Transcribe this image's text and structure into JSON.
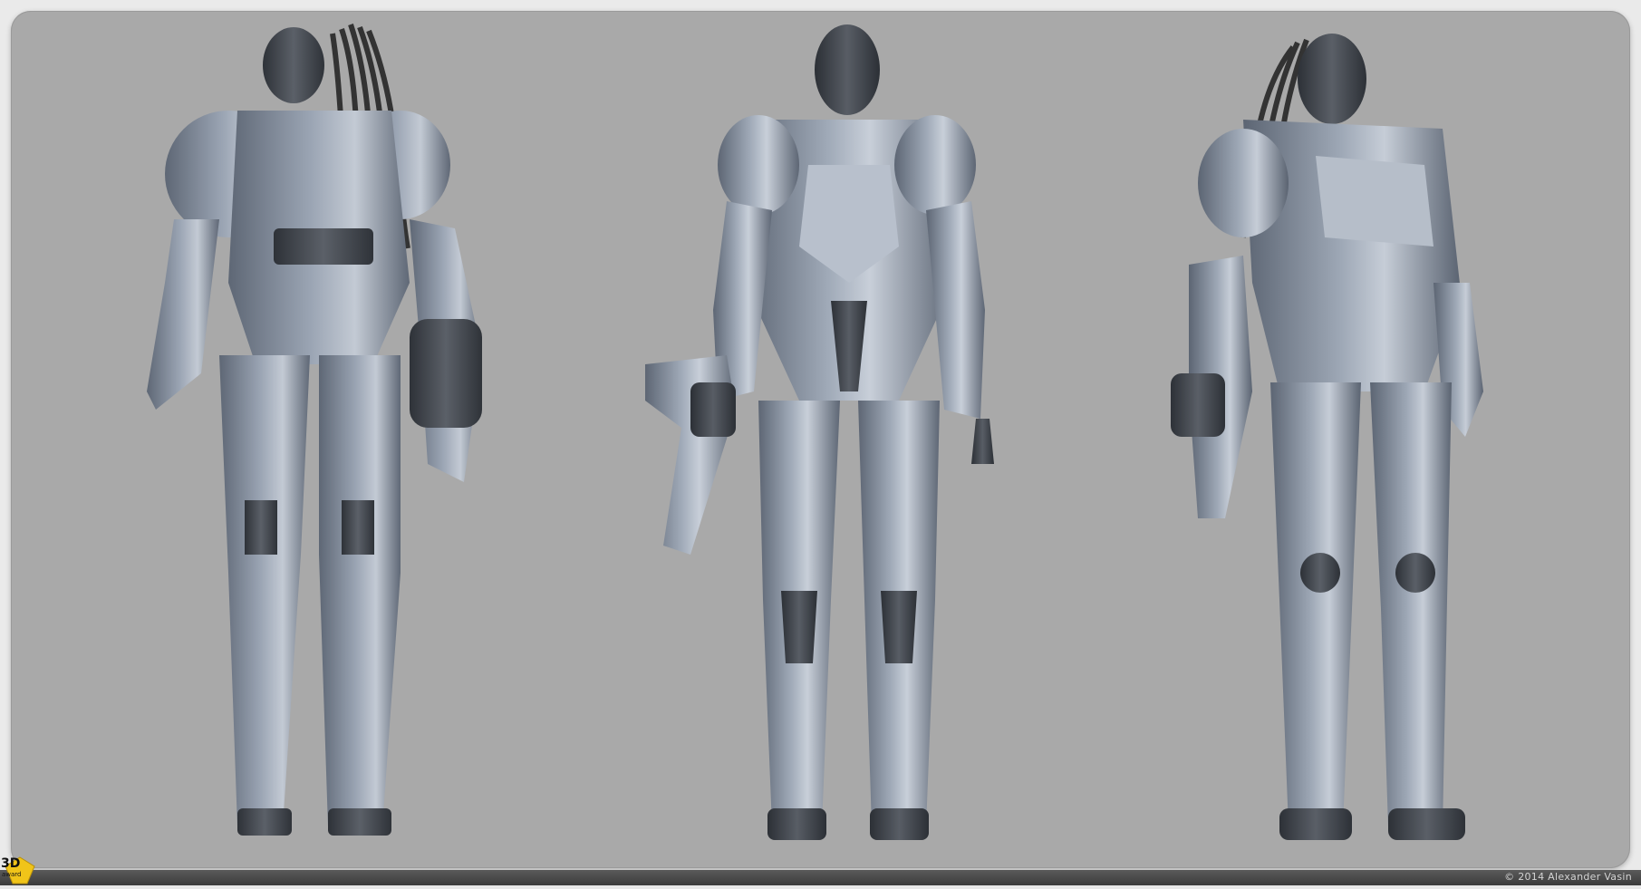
{
  "image": {
    "description_views": [
      "back-view",
      "front-view",
      "three-quarter-view"
    ],
    "background_color": "#a9a9a9",
    "armor_color": "#7f8a9a",
    "armor_dark": "#3d434c",
    "armor_highlight": "#c9d0da"
  },
  "footer": {
    "copyright": "© 2014 Alexander Vasin"
  },
  "badge": {
    "label": "3D",
    "sub": "award"
  }
}
